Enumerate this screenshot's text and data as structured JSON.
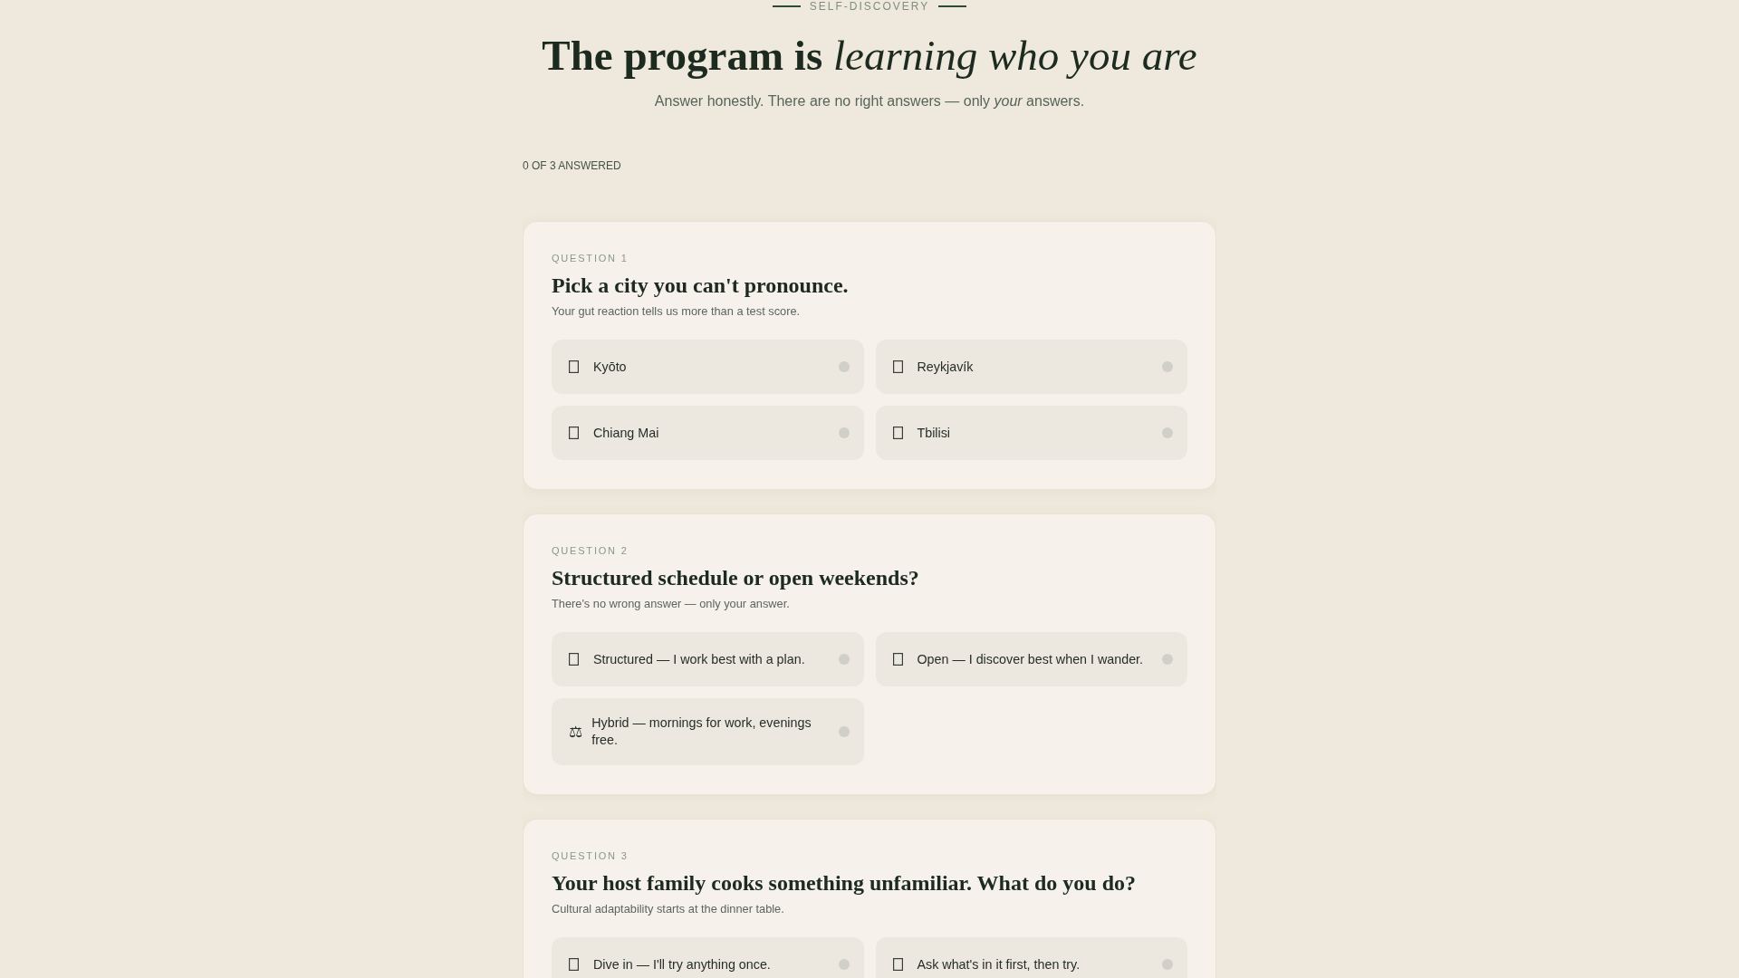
{
  "header": {
    "eyebrow": "SELF-DISCOVERY",
    "title": "**The program is** *learning who you are*",
    "intro": "Answer honestly. There are no right answers — only *your* answers."
  },
  "progress": "0 OF 3 ANSWERED",
  "questions": [
    {
      "number": "QUESTION 1",
      "title": "Pick a city you can't pronounce.",
      "hint": "Your gut reaction tells us more than a test score.",
      "options": [
        {
          "label": "Kyōto",
          "selected": false
        },
        {
          "label": "Reykjavík",
          "selected": false
        },
        {
          "label": "Chiang Mai",
          "selected": false
        },
        {
          "label": "Tbilisi",
          "selected": false
        }
      ]
    },
    {
      "number": "QUESTION 2",
      "title": "Structured schedule or open weekends?",
      "hint": "There's no wrong answer — only your answer.",
      "options": [
        {
          "label": "Structured — I work best with a plan.",
          "selected": false
        },
        {
          "label": "Open — I discover best when I wander.",
          "selected": false
        },
        {
          "icon": "⚖",
          "label": "Hybrid — mornings for work, evenings free.",
          "selected": false
        }
      ]
    },
    {
      "number": "QUESTION 3",
      "title": "Your host family cooks something unfamiliar. What do you do?",
      "hint": "Cultural adaptability starts at the dinner table.",
      "options": [
        {
          "label": "Dive in — I'll try anything once.",
          "selected": false
        },
        {
          "label": "Ask what's in it first, then try.",
          "selected": false
        }
      ]
    }
  ]
}
